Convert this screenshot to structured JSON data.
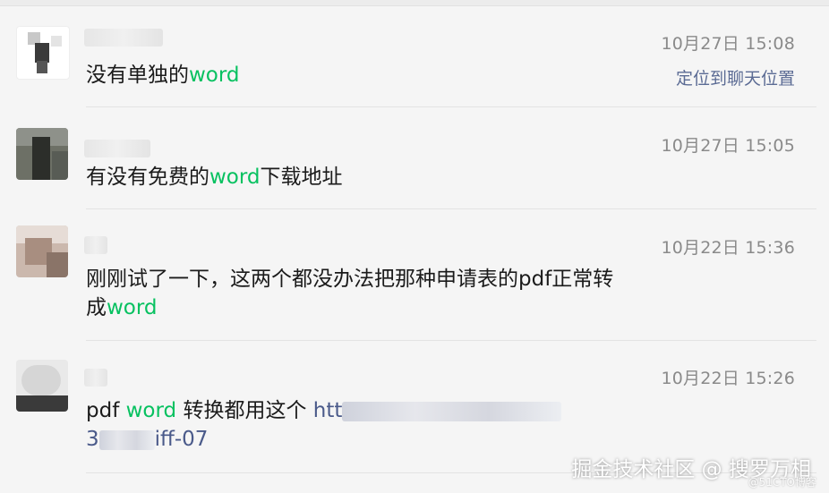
{
  "messages": [
    {
      "time": "10月27日 15:08",
      "action": "定位到聊天位置",
      "parts": [
        {
          "t": "没有单独的"
        },
        {
          "t": "word",
          "hl": true
        }
      ]
    },
    {
      "time": "10月27日 15:05",
      "parts": [
        {
          "t": "有没有免费的"
        },
        {
          "t": "word",
          "hl": true
        },
        {
          "t": "下载地址"
        }
      ]
    },
    {
      "time": "10月22日 15:36",
      "line1": "刚刚试了一下，这两个都没办法把那种申请表的pdf正常转",
      "line2": [
        {
          "t": "成"
        },
        {
          "t": "word",
          "hl": true
        }
      ]
    },
    {
      "time": "10月22日 15:26",
      "line1": [
        {
          "t": "pdf "
        },
        {
          "t": "word",
          "hl": true
        },
        {
          "t": " 转换都用这个 "
        },
        {
          "t": "htt",
          "link": true
        }
      ],
      "line2": [
        {
          "t": "3",
          "link": true
        },
        {
          "t": "iff-07",
          "link": true
        }
      ]
    }
  ],
  "watermark": "掘金技术社区 @ 搜罗万相",
  "watermark_small": "@51CTO博客",
  "colors": {
    "highlight": "#07c160",
    "link": "#5b6b94",
    "time": "#8a8a8a",
    "background": "#f5f5f5"
  }
}
